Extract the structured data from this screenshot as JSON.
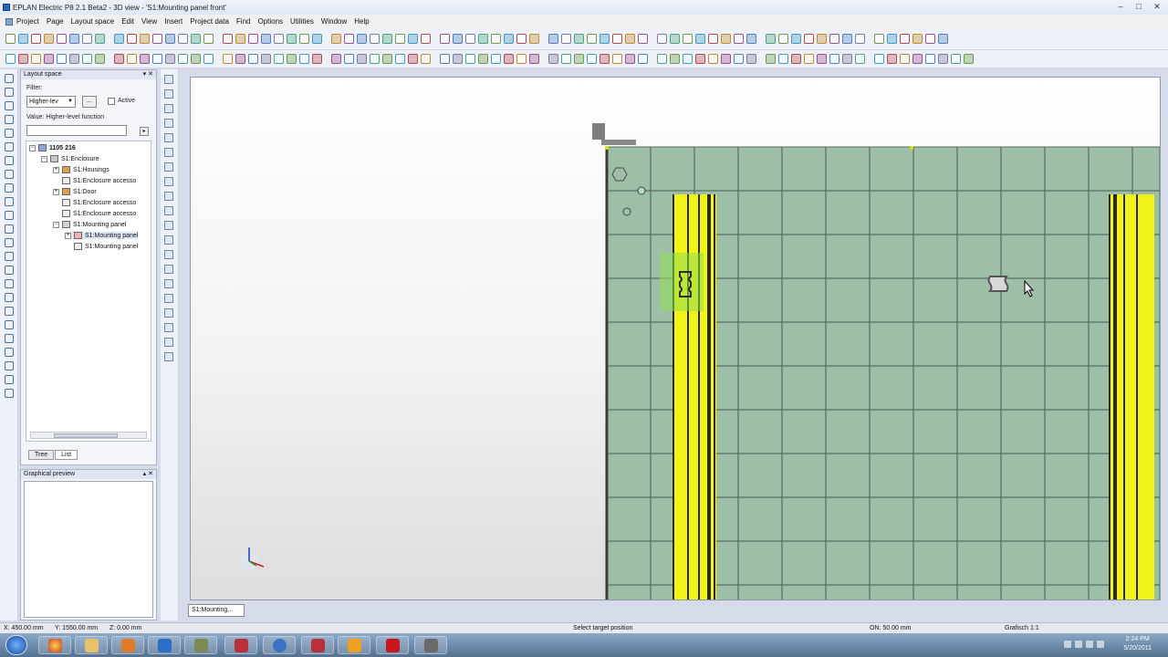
{
  "window": {
    "title": "EPLAN Electric P8 2.1 Beta2 - 3D view - 'S1:Mounting panel front'",
    "controls": [
      "–",
      "□",
      "✕"
    ]
  },
  "menu": [
    "Project",
    "Page",
    "Layout space",
    "Edit",
    "View",
    "Insert",
    "Project data",
    "Find",
    "Options",
    "Utilities",
    "Window",
    "Help"
  ],
  "layout_space": {
    "title": "Layout space",
    "filter_label": "Filter:",
    "filter_value": "Higher-lev",
    "dots": "...",
    "active_label": "Active",
    "value_label": "Value: Higher-level function",
    "tree": [
      {
        "label": "1105 216"
      },
      {
        "label": "S1:Enclosure"
      },
      {
        "label": "S1:Housings"
      },
      {
        "label": "S1:Enclosure accesso"
      },
      {
        "label": "S1:Door"
      },
      {
        "label": "S1:Enclosure accesso"
      },
      {
        "label": "S1:Enclosure accesso"
      },
      {
        "label": "S1:Mounting panel"
      },
      {
        "label": "S1:Mounting panel"
      },
      {
        "label": "S1:Mounting panel"
      }
    ],
    "tabs": [
      "Tree",
      "List"
    ]
  },
  "graphical_preview": {
    "title": "Graphical preview"
  },
  "document_tab": "S1:Mounting...",
  "status": {
    "x": "X: 450.00 mm",
    "y": "Y: 1550.00 mm",
    "z": "Z: 0.00 mm",
    "message": "Select target position",
    "on": "ON: 50.00 mm",
    "grafisch": "Grafisch 1:1"
  },
  "clock": {
    "time": "2:24 PM",
    "date": "5/20/2011"
  },
  "colors": {
    "panel_fill": "#9dbfa8",
    "grid_line": "#4c5a53",
    "rail_yellow": "#f0f21a",
    "rail_dark": "#2b2a1c",
    "highlight": "#8fe052"
  }
}
